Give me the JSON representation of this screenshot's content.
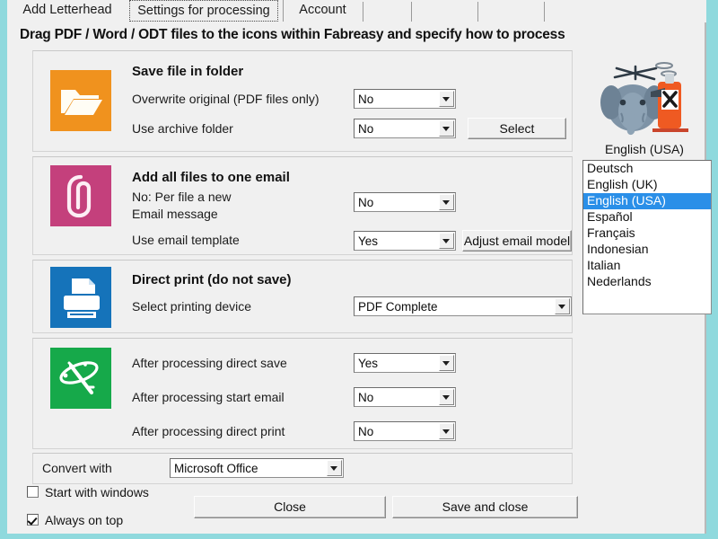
{
  "window": {
    "headline": "Drag PDF / Word / ODT files to the icons within Fabreasy and specify how to process"
  },
  "tabs": [
    {
      "label": "Add Letterhead",
      "selected": false
    },
    {
      "label": "Settings for processing",
      "selected": true
    },
    {
      "label": "Account",
      "selected": false
    }
  ],
  "groups": {
    "save": {
      "icon": "folder-icon",
      "icon_color": "#f0921e",
      "title": "Save file in folder",
      "rows": [
        {
          "label": "Overwrite original (PDF files only)",
          "value": "No"
        },
        {
          "label": "Use archive folder",
          "value": "No",
          "button": "Select"
        }
      ]
    },
    "email": {
      "icon": "paperclip-icon",
      "icon_color": "#c4407c",
      "title": "Add all files to one email",
      "subtitle_line1": "No: Per file a new",
      "subtitle_line2": "Email message",
      "rows": [
        {
          "label": "",
          "value": "No"
        },
        {
          "label": "Use email template",
          "value": "Yes",
          "button": "Adjust email model"
        }
      ]
    },
    "print": {
      "icon": "printer-icon",
      "icon_color": "#1573ba",
      "title": "Direct print (do not save)",
      "rows": [
        {
          "label": "Select printing device",
          "value": "PDF Complete"
        }
      ]
    },
    "after": {
      "icon": "magic-wand-icon",
      "icon_color": "#16a94a",
      "title": "",
      "rows": [
        {
          "label": "After processing direct save",
          "value": "Yes"
        },
        {
          "label": "After processing start email",
          "value": "No"
        },
        {
          "label": "After processing direct print",
          "value": "No"
        }
      ]
    }
  },
  "convert": {
    "label": "Convert with",
    "value": "Microsoft Office"
  },
  "checkboxes": [
    {
      "label": "Start with windows",
      "checked": false
    },
    {
      "label": "Always on top",
      "checked": true
    }
  ],
  "footer_buttons": {
    "close": "Close",
    "save_and_close": "Save and close"
  },
  "language": {
    "caption": "English (USA)",
    "mascot_icon": "elephant-spray-bottle-icon",
    "options": [
      "Deutsch",
      "English (UK)",
      "English (USA)",
      "Español",
      "Français",
      "Indonesian",
      "Italian",
      "Nederlands"
    ],
    "selected": "English (USA)"
  },
  "colors": {
    "accent_selection": "#2a8fe8",
    "desktop_edge": "#8fd9dd",
    "dialog_bg": "#f0f0f0"
  }
}
